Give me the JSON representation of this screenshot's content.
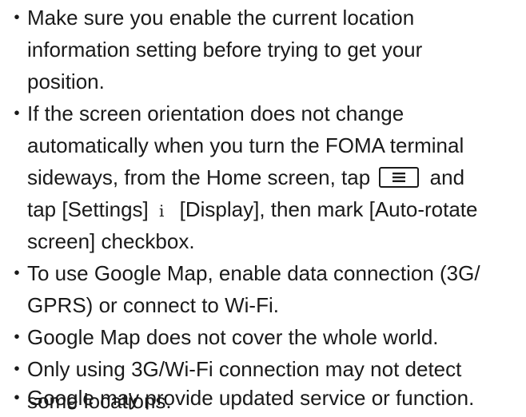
{
  "notes": [
    {
      "lines": [
        "Make sure you enable the current location",
        "information setting before trying to get your",
        "position."
      ]
    },
    {
      "lines": [
        "If the screen orientation does not change",
        "automatically when you turn the FOMA terminal"
      ],
      "line3_before": "sideways, from the Home screen, tap",
      "line3_after": "and",
      "line4_before": "tap [Settings]",
      "line4_arrow": "i",
      "line4_after": "[Display], then mark [Auto-rotate",
      "line5": "screen] checkbox."
    },
    {
      "lines": [
        "To use Google Map, enable data connection (3G/",
        "GPRS) or connect to Wi-Fi."
      ]
    },
    {
      "lines": [
        "Google Map does not cover the whole world."
      ]
    },
    {
      "lines": [
        "Only using 3G/Wi-Fi connection may not detect",
        "some locations."
      ]
    },
    {
      "lines": [
        "Google may provide updated service or function."
      ]
    }
  ],
  "bullet_symbol": "・",
  "menu_key_icon": "menu-key-icon",
  "text_color": "#1a1a1a",
  "background": "#ffffff"
}
